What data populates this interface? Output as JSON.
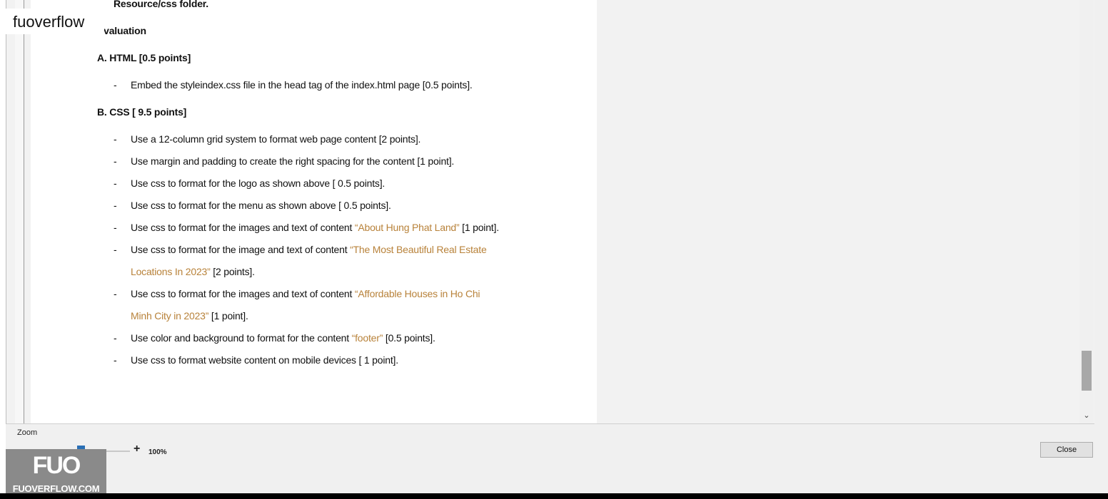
{
  "watermark": {
    "top_text": "fuoverflow",
    "logo_mark": "FUO",
    "logo_text": "FUOVERFLOW.COM"
  },
  "document": {
    "line_resource": "Resource/css  folder.",
    "heading_evaluation": "Evaluation",
    "section_a": "A. HTML  [0.5 points]",
    "a_items": [
      "Embed the styleindex.css file in the head tag of the index.html page [0.5 points]."
    ],
    "section_b": "B. CSS  [ 9.5 points]",
    "b1": "Use a 12-column grid system to format web page content [2 points].",
    "b2": "Use margin and padding to create the right spacing for the content [1 point].",
    "b3": "Use css to format for the logo as shown above [ 0.5 points].",
    "b4": "Use css to format for the menu as shown above [ 0.5 points].",
    "b5_pre": "Use css to format for the images and text of content ",
    "b5_hl": "“About Hung Phat Land”",
    "b5_post": " [1 point].",
    "b6_pre": "Use css  to format for the image and text of content ",
    "b6_hl1": "“The Most Beautiful Real Estate",
    "b6_hl2": "Locations In 2023”",
    "b6_post": " [2 points].",
    "b7_pre": "Use css  to format for the images and text of  content ",
    "b7_hl1": "“Affordable Houses in Ho Chi",
    "b7_hl2": "Minh City in 2023”",
    "b7_post": " [1 point].",
    "b8_pre": "Use color and background  to format for the content ",
    "b8_hl": "“footer”",
    "b8_post": " [0.5 points].",
    "b9": "Use css to format website content on mobile devices [ 1 point].",
    "dash": "-"
  },
  "zoom": {
    "label": "Zoom",
    "minus": "-",
    "plus": "+",
    "value": "100%",
    "level_percent": 100
  },
  "buttons": {
    "close": "Close"
  },
  "colors": {
    "highlight": "#b8823a",
    "slider_thumb": "#2a6fb5"
  }
}
